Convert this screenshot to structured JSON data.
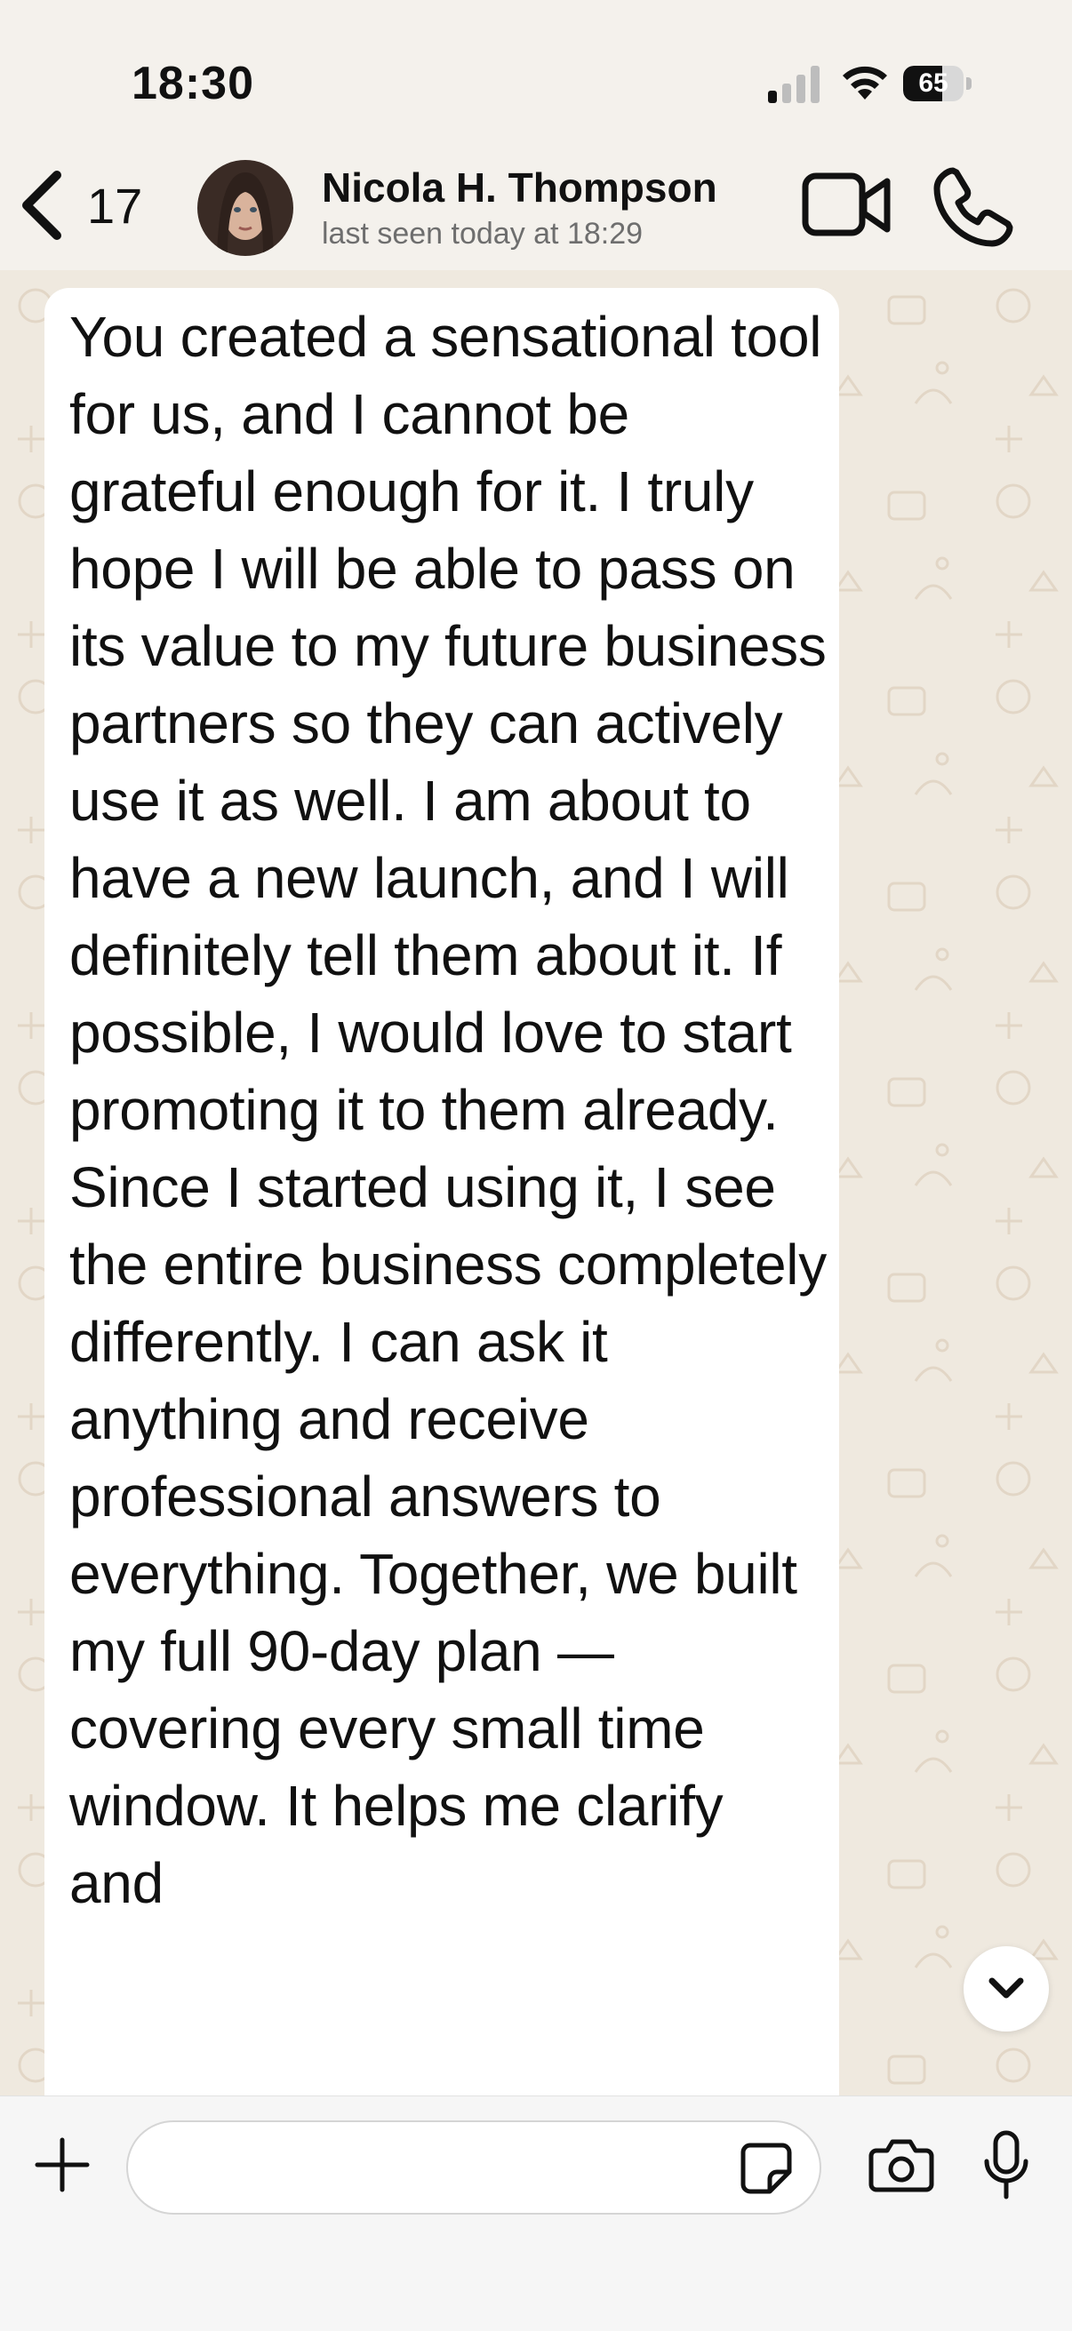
{
  "status_bar": {
    "time": "18:30",
    "battery_percent": "65",
    "battery_level": 0.65,
    "icons": [
      "cellular-signal-icon",
      "wifi-icon",
      "battery-icon"
    ]
  },
  "header": {
    "back_count": "17",
    "contact_name": "Nicola H. Thompson",
    "contact_status": "last seen today at 18:29",
    "icons": [
      "back-chevron-icon",
      "avatar",
      "video-call-icon",
      "phone-call-icon"
    ]
  },
  "chat": {
    "message_text": "You created a sensational tool for us, and I cannot be grateful enough for it. I truly hope I will be able to pass on its value to my future business partners so they can actively use it as well. I am about to have a new launch, and I will definitely tell them about it. If possible, I would love to start promoting it to them already.\nSince I started using it, I see the entire business completely differently. I can ask it anything and receive professional answers to everything. Together, we built my full 90-day plan — covering every small time window. It helps me clarify and",
    "scroll_icon": "chevron-down-icon"
  },
  "input_bar": {
    "placeholder": "",
    "icons": [
      "plus-icon",
      "sticker-icon",
      "camera-icon",
      "microphone-icon"
    ]
  },
  "colors": {
    "background": "#f4f1ec",
    "wallpaper": "#efe9df",
    "bubble": "#ffffff",
    "text": "#111111",
    "muted": "#6e6e6e"
  }
}
